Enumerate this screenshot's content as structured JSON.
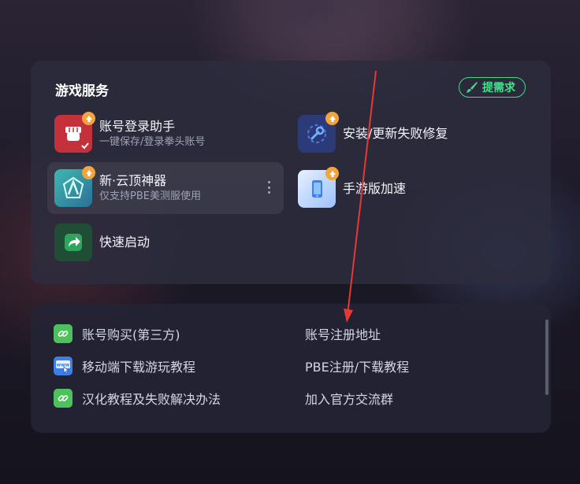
{
  "services": {
    "title": "游戏服务",
    "request_label": "提需求",
    "items": [
      {
        "name": "账号登录助手",
        "sub": "一键保存/登录拳头账号"
      },
      {
        "name": "安装/更新失败修复",
        "sub": ""
      },
      {
        "name": "新·云顶神器",
        "sub": "仅支持PBE美测服使用"
      },
      {
        "name": "手游版加速",
        "sub": ""
      },
      {
        "name": "快速启动",
        "sub": ""
      }
    ]
  },
  "links": {
    "left": [
      {
        "label": "账号购买(第三方)",
        "icon": "link-icon"
      },
      {
        "label": "移动端下载游玩教程",
        "icon": "www-cursor-icon"
      },
      {
        "label": "汉化教程及失败解决办法",
        "icon": "link-icon"
      }
    ],
    "right": [
      {
        "label": "账号注册地址"
      },
      {
        "label": "PBE注册/下载教程"
      },
      {
        "label": "加入官方交流群"
      }
    ]
  },
  "colors": {
    "accent_green": "#45e08e",
    "badge_orange": "#f3a43c",
    "annotation_red": "#e53935"
  }
}
